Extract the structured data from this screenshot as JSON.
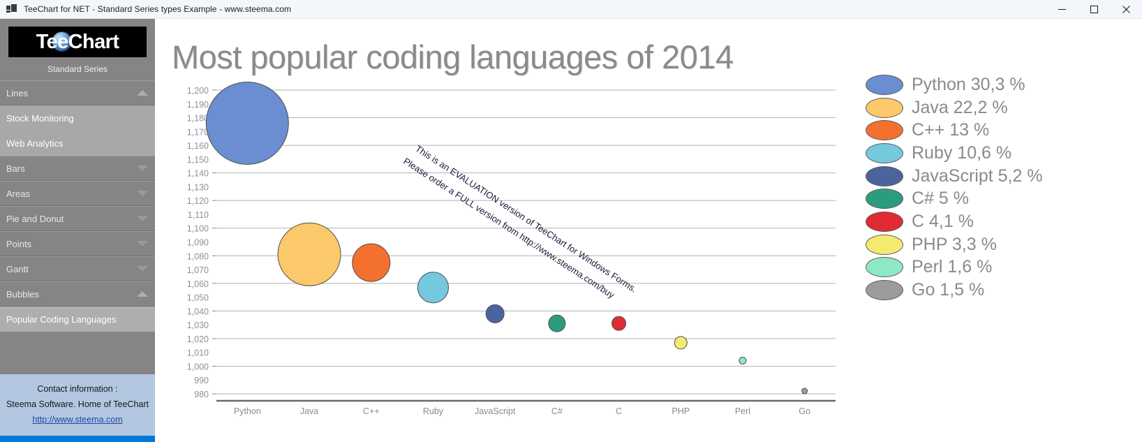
{
  "window": {
    "title": "TeeChart for NET - Standard Series types Example - www.steema.com",
    "app_icon": "app-window-icon",
    "minimize": "minimize-icon",
    "maximize": "maximize-icon",
    "close": "close-icon"
  },
  "sidebar": {
    "logo_text": "TeeChart",
    "logo_subtitle": "Standard Series",
    "menu": [
      {
        "label": "Lines",
        "state": "expanded",
        "caret": "chevron-up-icon",
        "children": [
          {
            "label": "Stock Monitoring",
            "selected": false
          },
          {
            "label": "Web Analytics",
            "selected": false
          }
        ]
      },
      {
        "label": "Bars",
        "state": "collapsed",
        "caret": "chevron-down-icon",
        "children": []
      },
      {
        "label": "Areas",
        "state": "collapsed",
        "caret": "chevron-down-icon",
        "children": []
      },
      {
        "label": "Pie and Donut",
        "state": "collapsed",
        "caret": "chevron-down-icon",
        "children": []
      },
      {
        "label": "Points",
        "state": "collapsed",
        "caret": "chevron-down-icon",
        "children": []
      },
      {
        "label": "Gantt",
        "state": "collapsed",
        "caret": "chevron-down-icon",
        "children": []
      },
      {
        "label": "Bubbles",
        "state": "expanded",
        "caret": "chevron-up-icon",
        "children": [
          {
            "label": "Popular Coding Languages",
            "selected": true
          }
        ]
      }
    ],
    "contact": {
      "heading": "Contact information :",
      "company": "Steema Software. Home of TeeChart",
      "link": "http://www.steema.com"
    }
  },
  "watermark": {
    "line1": "This is an EVALUATION version of TeeChart for Windows Forms.",
    "line2": "Please order a FULL version from http://www.steema.com/buy"
  },
  "chart_data": {
    "type": "bubble",
    "title": "Most popular coding languages of 2014",
    "xlabel": "",
    "ylabel": "",
    "grid": true,
    "legend_position": "right",
    "ylim": [
      975,
      1205
    ],
    "yticks": [
      1200,
      1190,
      1180,
      1170,
      1160,
      1150,
      1140,
      1130,
      1120,
      1110,
      1100,
      1090,
      1080,
      1070,
      1060,
      1050,
      1040,
      1030,
      1020,
      1010,
      1000,
      990,
      980
    ],
    "ytick_labels": [
      "1,200",
      "1,190",
      "1,180",
      "1,170",
      "1,160",
      "1,150",
      "1,140",
      "1,130",
      "1,120",
      "1,110",
      "1,100",
      "1,090",
      "1,080",
      "1,070",
      "1,060",
      "1,050",
      "1,040",
      "1,030",
      "1,020",
      "1,010",
      "1,000",
      "990",
      "980"
    ],
    "categories": [
      "Python",
      "Java",
      "C++",
      "Ruby",
      "JavaScript",
      "C#",
      "C",
      "PHP",
      "Perl",
      "Go"
    ],
    "points": [
      {
        "label": "Python",
        "x": 1,
        "y": 1176,
        "size": 30.3,
        "radius_px": 59,
        "color": "#6b8dd1"
      },
      {
        "label": "Java",
        "x": 2,
        "y": 1081,
        "size": 22.2,
        "radius_px": 45,
        "color": "#fbc96a"
      },
      {
        "label": "C++",
        "x": 3,
        "y": 1075,
        "size": 13.0,
        "radius_px": 27,
        "color": "#f4702e"
      },
      {
        "label": "Ruby",
        "x": 4,
        "y": 1057,
        "size": 10.6,
        "radius_px": 22,
        "color": "#74c9de"
      },
      {
        "label": "JavaScript",
        "x": 5,
        "y": 1038,
        "size": 5.2,
        "radius_px": 13,
        "color": "#4c649e"
      },
      {
        "label": "C#",
        "x": 6,
        "y": 1031,
        "size": 5.0,
        "radius_px": 12,
        "color": "#2c9c7f"
      },
      {
        "label": "C",
        "x": 7,
        "y": 1031,
        "size": 4.1,
        "radius_px": 10,
        "color": "#e02b35"
      },
      {
        "label": "PHP",
        "x": 8,
        "y": 1017,
        "size": 3.3,
        "radius_px": 9,
        "color": "#f5ea70"
      },
      {
        "label": "Perl",
        "x": 9,
        "y": 1004,
        "size": 1.6,
        "radius_px": 5,
        "color": "#8fe8c4"
      },
      {
        "label": "Go",
        "x": 10,
        "y": 982,
        "size": 1.5,
        "radius_px": 4,
        "color": "#9c9c9c"
      }
    ],
    "legend": [
      {
        "label": "Python 30,3 %",
        "color": "#6b8dd1"
      },
      {
        "label": "Java 22,2 %",
        "color": "#fbc96a"
      },
      {
        "label": "C++ 13 %",
        "color": "#f4702e"
      },
      {
        "label": "Ruby 10,6 %",
        "color": "#74c9de"
      },
      {
        "label": "JavaScript 5,2 %",
        "color": "#4c649e"
      },
      {
        "label": "C# 5 %",
        "color": "#2c9c7f"
      },
      {
        "label": "C 4,1 %",
        "color": "#e02b35"
      },
      {
        "label": "PHP 3,3 %",
        "color": "#f5ea70"
      },
      {
        "label": "Perl 1,6 %",
        "color": "#8fe8c4"
      },
      {
        "label": "Go 1,5 %",
        "color": "#9c9c9c"
      }
    ]
  }
}
